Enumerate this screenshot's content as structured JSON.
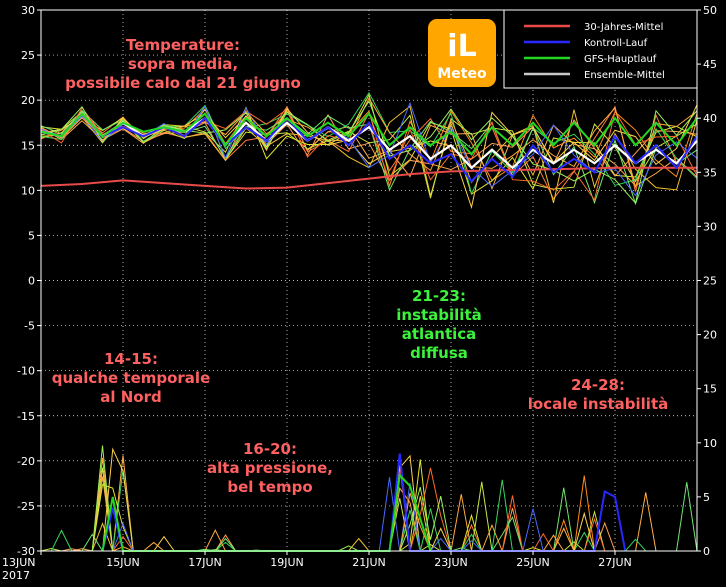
{
  "colors": {
    "background": "#000000",
    "frame": "#ffffff",
    "title_red": "#ff6161",
    "title_green": "#3cf23c",
    "mean_30y": "#e84a4a",
    "control_run": "#2828ff",
    "gfs_main": "#22d622",
    "ensemble_mean": "#c8c8c8",
    "logo": "#ffa600"
  },
  "logo": {
    "text_top": "iL",
    "text_bottom": "Meteo"
  },
  "annotations": [
    {
      "id": "temp",
      "color": "title_red",
      "lines": [
        "Temperature:",
        "sopra media,",
        "possibile calo dal 21 giugno"
      ]
    },
    {
      "id": "a1415",
      "color": "title_red",
      "lines": [
        "14-15:",
        "qualche temporale",
        "al Nord"
      ]
    },
    {
      "id": "a1620",
      "color": "title_red",
      "lines": [
        "16-20:",
        "alta pressione,",
        "bel tempo"
      ]
    },
    {
      "id": "a2123",
      "color": "title_green",
      "lines": [
        "21-23:",
        "instabilità",
        "atlantica",
        "diffusa"
      ]
    },
    {
      "id": "a2428",
      "color": "title_red",
      "lines": [
        "24-28:",
        "locale instabilità"
      ]
    }
  ],
  "chart_data": {
    "type": "line",
    "x": [
      "13JUN 2017",
      "15JUN",
      "17JUN",
      "19JUN",
      "21JUN",
      "23JUN",
      "25JUN",
      "27JUN"
    ],
    "x_tick_labels": [
      "13JUN",
      "15JUN",
      "17JUN",
      "19JUN",
      "21JUN",
      "23JUN",
      "25JUN",
      "27JUN"
    ],
    "x_first_tick_year": "2017",
    "x_range_days": [
      13,
      29
    ],
    "left_axis": {
      "ticks": [
        30,
        25,
        20,
        15,
        10,
        5,
        0,
        -5,
        -10,
        -15,
        -20,
        -25,
        -30
      ],
      "ylim": [
        -30,
        30
      ],
      "quantity": "temperature"
    },
    "right_axis": {
      "ticks": [
        50,
        45,
        40,
        35,
        30,
        25,
        20,
        15,
        10,
        5,
        0
      ],
      "ylim": [
        0,
        50
      ],
      "quantity": "precipitation"
    },
    "legend": {
      "placement": "top-right",
      "entries": [
        {
          "label": "30-Jahres-Mittel",
          "color": "mean_30y"
        },
        {
          "label": "Kontroll-Lauf",
          "color": "control_run"
        },
        {
          "label": "GFS-Hauptlauf",
          "color": "gfs_main"
        },
        {
          "label": "Ensemble-Mittel",
          "color": "ensemble_mean"
        }
      ]
    },
    "series": [
      {
        "name": "30-Jahres-Mittel",
        "color": "mean_30y",
        "axis": "left",
        "x": [
          13,
          14,
          15,
          16,
          17,
          18,
          19,
          20,
          21,
          22,
          23,
          24,
          25,
          26,
          27,
          28,
          29
        ],
        "values": [
          10.5,
          10.7,
          11.1,
          10.8,
          10.5,
          10.2,
          10.3,
          10.8,
          11.3,
          11.8,
          12.1,
          12.2,
          12.3,
          12.4,
          12.5,
          12.5,
          12.5
        ]
      },
      {
        "name": "Ensemble-Mittel",
        "color": "ensemble_mean",
        "axis": "left",
        "x": [
          13,
          13.5,
          14,
          14.5,
          15,
          15.5,
          16,
          16.5,
          17,
          17.5,
          18,
          18.5,
          19,
          19.5,
          20,
          20.5,
          21,
          21.5,
          22,
          22.5,
          23,
          23.5,
          24,
          24.5,
          25,
          25.5,
          26,
          26.5,
          27,
          27.5,
          28,
          28.5,
          29
        ],
        "values": [
          16.5,
          16,
          18.5,
          16,
          17.5,
          16,
          17,
          16.5,
          18,
          15,
          17.5,
          15.5,
          17.5,
          15.5,
          17,
          15.5,
          17,
          14.5,
          16,
          13.5,
          15,
          12.5,
          14.5,
          12.5,
          14.5,
          13,
          14.5,
          13,
          15,
          13,
          14.5,
          13,
          15.5
        ]
      },
      {
        "name": "Kontroll-Lauf",
        "color": "control_run",
        "axis": "left",
        "x": [
          13,
          13.5,
          14,
          14.5,
          15,
          15.5,
          16,
          16.5,
          17,
          17.5,
          18,
          18.5,
          19,
          19.5,
          20,
          20.5,
          21,
          21.5,
          22,
          22.5,
          23,
          23.5,
          24,
          24.5,
          25,
          25.5,
          26,
          26.5,
          27,
          27.5,
          28,
          28.5,
          29
        ],
        "values": [
          16.5,
          16,
          18.5,
          16,
          17,
          16,
          17,
          16,
          18,
          15,
          17,
          15.5,
          18,
          15.5,
          17,
          15,
          17.5,
          13.5,
          15,
          13,
          14,
          11,
          13.5,
          11.5,
          15,
          12,
          13.5,
          12,
          16,
          13,
          15,
          12.5,
          16
        ]
      },
      {
        "name": "GFS-Hauptlauf",
        "color": "gfs_main",
        "axis": "left",
        "x": [
          13,
          13.5,
          14,
          14.5,
          15,
          15.5,
          16,
          16.5,
          17,
          17.5,
          18,
          18.5,
          19,
          19.5,
          20,
          20.5,
          21,
          21.5,
          22,
          22.5,
          23,
          23.5,
          24,
          24.5,
          25,
          25.5,
          26,
          26.5,
          27,
          27.5,
          28,
          28.5,
          29
        ],
        "values": [
          16.5,
          16,
          18.5,
          16,
          17.5,
          16.5,
          17,
          16.5,
          18.5,
          15,
          18,
          16,
          18,
          16,
          17.5,
          16,
          18.5,
          15,
          17,
          15,
          16.5,
          14,
          17,
          15,
          17.5,
          15,
          17.5,
          15,
          18,
          15,
          17.5,
          15,
          18
        ]
      },
      {
        "name": "Kontroll-Lauf precipitation",
        "color": "control_run",
        "axis": "right",
        "x": [
          14.5,
          14.75,
          15,
          21.5,
          21.75,
          22,
          22.25,
          26.5,
          26.75,
          27,
          27.25
        ],
        "values": [
          0,
          4,
          0,
          0,
          9,
          0,
          0,
          0,
          5.5,
          5,
          0
        ]
      },
      {
        "name": "GFS-Hauptlauf precipitation",
        "color": "gfs_main",
        "axis": "right",
        "x": [
          14.5,
          14.75,
          15,
          15.5,
          21.5,
          21.75,
          22,
          22.25,
          22.5
        ],
        "values": [
          0,
          5,
          0,
          0,
          0,
          7,
          6,
          3,
          0
        ]
      }
    ]
  }
}
